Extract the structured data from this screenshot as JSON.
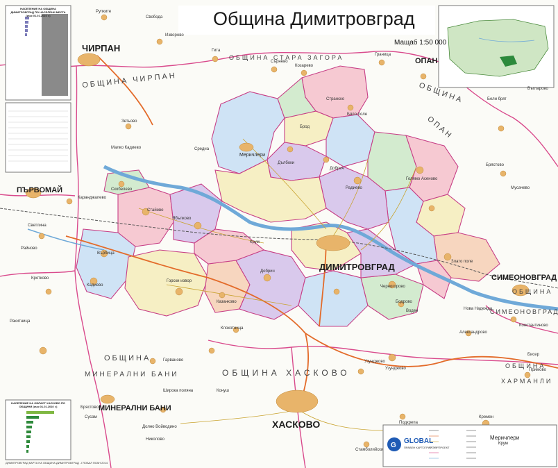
{
  "header": {
    "title": "Община Димитровград",
    "scale": "Мащаб 1:50 000"
  },
  "labels": {
    "cities": {
      "dimitrovgrad": "ДИМИТРОВГРАД",
      "haskovo": "ХАСКОВО",
      "chirpan": "ЧИРПАН",
      "parvomay": "ПЪРВОМАЙ",
      "opan": "ОПАН",
      "simeonovgrad": "СИМЕОНОВГРАД",
      "mineralni_bani": "МИНЕРАЛНИ БАНИ",
      "merichleri_town": "Меричлери",
      "merichleri_se": "Меричлери",
      "krum": "Крум"
    },
    "municipalities": {
      "obshtina_chirpan": "ОБЩИНА ЧИРПАН",
      "obshtina_stara_zagora": "ОБЩИНА СТАРА ЗАГОРА",
      "obshtina_opan_top": "ОБЩИНА",
      "obshtina_opan": "ОПАН",
      "obshtina_simeonovgrad_top": "ОБЩИНА",
      "obshtina_simeonovgrad": "СИМЕОНОВГРАД",
      "obshtina_haskovo": "ОБЩИНА ХАСКОВО",
      "obshtina_mineralni_top": "ОБЩИНА",
      "obshtina_mineralni": "МИНЕРАЛНИ БАНИ",
      "obshtina_harmanli_top": "ОБЩИНА",
      "obshtina_harmanli": "ХАРМАНЛИ"
    },
    "villages": [
      "Свобода",
      "Рупките",
      "Изворово",
      "Гита",
      "Сърнево",
      "Козарево",
      "Граница",
      "Зетьово",
      "Малко Кадиево",
      "Средна",
      "Брод",
      "Странско",
      "Бяло поле",
      "Дълбоки",
      "Радиево",
      "Голямо Асеново",
      "Добрич",
      "Брястово",
      "Мусачево",
      "Скобелево",
      "Каранджалево",
      "Стайево",
      "Ябълково",
      "Крум",
      "Върбица",
      "Черногорово",
      "Горски извор",
      "Кадиево",
      "Казанково",
      "Добрич",
      "Бодрово",
      "Злато поле",
      "Нова Надежда",
      "Александрово",
      "Клокотница",
      "Гарваново",
      "Сусам",
      "Брястово",
      "Долно Войводино",
      "Николово",
      "Широка поляна",
      "Стамболийски",
      "Подкрепа",
      "Конуш",
      "Кремен",
      "Константиново",
      "Узунджово",
      "Бисер",
      "Примово",
      "Узунджово",
      "Райново",
      "Кротково",
      "Светлина",
      "Воден",
      "Бели бряг",
      "Ракитница",
      "Въгларово"
    ]
  },
  "tables": {
    "population_title": "НАСЕЛЕНИЕ НА ОБЩИНА ДИМИТРОВГРАД ПО НАСЕЛЕНИ МЕСТА (към 01.01.2010 г.)",
    "haskovo_title": "НАСЕЛЕНИЕ НА ОБЛАСТ ХАСКОВО ПО ОБЩИНИ (към 01.01.2010 г.)",
    "footer_publisher": "ДИМИТРОВГРАД КАРТА НА ОБЩИНА ДИМИТРОВГРАД - ГЛОБАЛ ПЛАН 2014"
  },
  "legend": {
    "logo_text": "GLOBAL",
    "logo_subtext": "ПРАВЕН КАРТОГРАФСКИ ПРОЕКТ"
  },
  "colors": {
    "flag_white": "#ffffff",
    "flag_green": "#00966e",
    "flag_red": "#d62612",
    "eu_blue": "#003399",
    "eu_star": "#ffcc00",
    "border": "#d52a7c",
    "river": "#6fa9d8",
    "road_main": "#e36b2a",
    "region_pink": "#f6c9d2",
    "region_blue": "#cfe3f5",
    "region_yellow": "#f6efc4",
    "region_purple": "#d9c9ec",
    "region_green": "#d3ebcf",
    "region_peach": "#f7d6bf",
    "settlement": "#e8b46a"
  }
}
